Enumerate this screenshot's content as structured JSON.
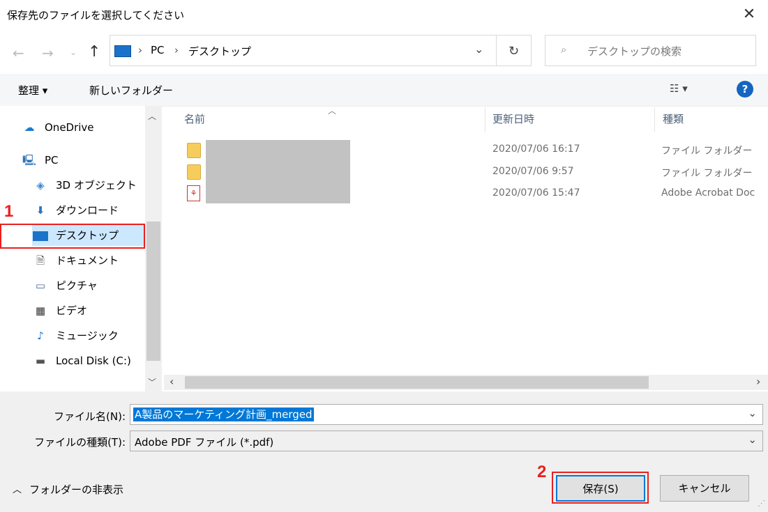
{
  "window": {
    "title": "保存先のファイルを選択してください"
  },
  "address": {
    "crumbs": [
      "PC",
      "デスクトップ"
    ],
    "separator": "›"
  },
  "search": {
    "placeholder": "デスクトップの検索"
  },
  "toolbar": {
    "organize": "整理 ▾",
    "new_folder": "新しいフォルダー"
  },
  "sidebar": {
    "items": [
      {
        "label": "OneDrive",
        "icon": "cloud-icon"
      },
      {
        "label": "PC",
        "icon": "computer-icon"
      },
      {
        "label": "3D オブジェクト",
        "icon": "cube-icon"
      },
      {
        "label": "ダウンロード",
        "icon": "download-icon"
      },
      {
        "label": "デスクトップ",
        "icon": "desktop-icon"
      },
      {
        "label": "ドキュメント",
        "icon": "document-icon"
      },
      {
        "label": "ピクチャ",
        "icon": "picture-icon"
      },
      {
        "label": "ビデオ",
        "icon": "video-icon"
      },
      {
        "label": "ミュージック",
        "icon": "music-icon"
      },
      {
        "label": "Local Disk (C:)",
        "icon": "disk-icon"
      }
    ]
  },
  "columns": {
    "name": "名前",
    "modified": "更新日時",
    "type": "種類"
  },
  "files": [
    {
      "date": "2020/07/06 16:17",
      "type": "ファイル フォルダー",
      "icon": "folder-icon"
    },
    {
      "date": "2020/07/06 9:57",
      "type": "ファイル フォルダー",
      "icon": "folder-icon"
    },
    {
      "date": "2020/07/06 15:47",
      "type": "Adobe Acrobat Doc",
      "icon": "pdf-icon"
    }
  ],
  "form": {
    "filename_label": "ファイル名(N):",
    "filename_value": "A製品のマーケティング計画_merged",
    "filetype_label": "ファイルの種類(T):",
    "filetype_value": "Adobe PDF ファイル (*.pdf)"
  },
  "footer": {
    "hide_folders": "フォルダーの非表示",
    "save": "保存(S)",
    "cancel": "キャンセル"
  },
  "annotations": {
    "step1": "1",
    "step2": "2",
    "color": "#e8201e"
  }
}
